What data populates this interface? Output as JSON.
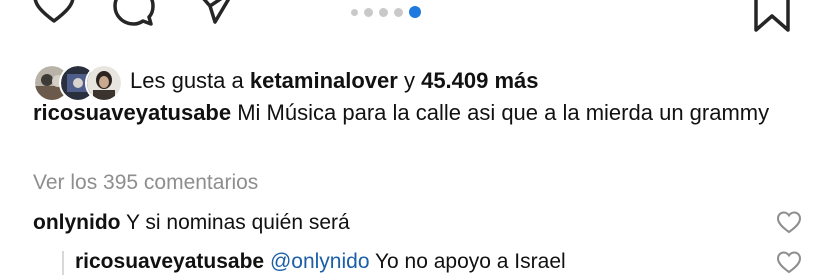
{
  "actions": {
    "like_icon": "heart-outline-icon",
    "comment_icon": "speech-bubble-icon",
    "share_icon": "paper-plane-icon",
    "save_icon": "bookmark-icon"
  },
  "carousel": {
    "total_dots": 5,
    "active_index": 4,
    "active_color": "#1f7ae0",
    "inactive_color": "#c9c9c9"
  },
  "likes": {
    "prefix": "Les gusta a ",
    "user": "ketaminalover",
    "connector": " y ",
    "count": "45.409 más"
  },
  "caption": {
    "username": "ricosuaveyatusabe",
    "text": " Mi Música para la calle asi que a la mierda un grammy"
  },
  "view_comments": "Ver los 395 comentarios",
  "comments": [
    {
      "username": "onlynido",
      "text": " Y si nominas quién será"
    }
  ],
  "reply": {
    "username": "ricosuaveyatusabe",
    "mention": "@onlynido",
    "text": " Yo no apoyo a Israel"
  },
  "colors": {
    "text": "#111111",
    "secondary": "#8e8e8e",
    "mention": "#1c5fa8",
    "icon_stroke": "#262626"
  }
}
